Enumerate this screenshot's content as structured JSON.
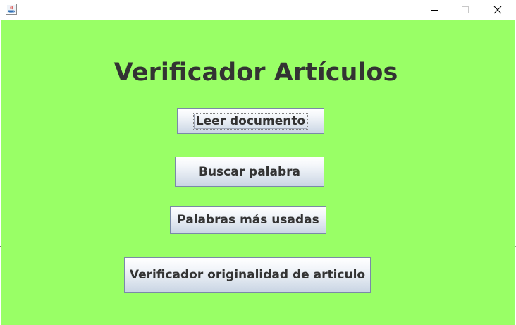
{
  "window": {
    "title": "",
    "controls": {
      "minimize_icon": "minimize-icon",
      "maximize_icon": "maximize-icon",
      "close_icon": "close-icon"
    }
  },
  "main": {
    "background": "#99ff66",
    "title": "Verificador Artículos",
    "buttons": {
      "read_document": "Leer documento",
      "search_word": "Buscar palabra",
      "most_used_words": "Palabras más usadas",
      "originality_check": "Verificador originalidad de articulo"
    }
  }
}
